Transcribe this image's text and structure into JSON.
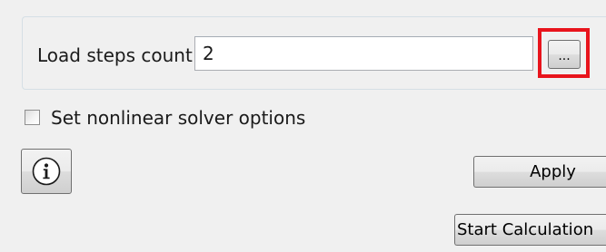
{
  "load_steps": {
    "label": "Load steps count",
    "value": "2",
    "browse_button_label": "..."
  },
  "nonlinear": {
    "checkbox_label": "Set nonlinear solver options",
    "checked": false
  },
  "actions": {
    "info_icon": "info-circle-icon",
    "apply_label": "Apply",
    "start_label": "Start Calculation"
  },
  "colors": {
    "highlight": "#e8141c",
    "window_background": "#f0f0f0"
  }
}
